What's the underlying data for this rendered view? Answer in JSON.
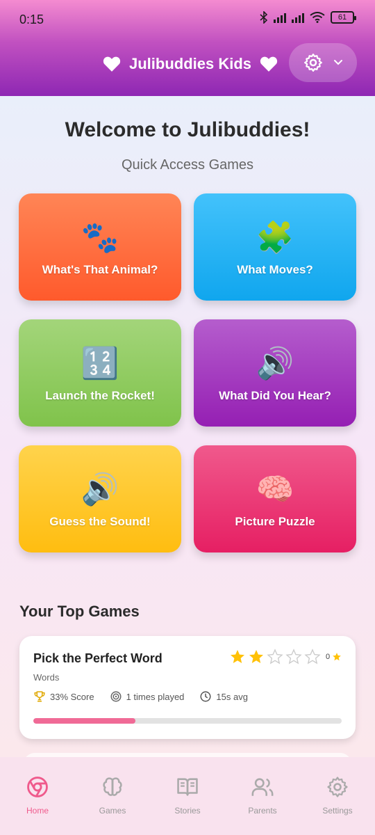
{
  "status_bar": {
    "time": "0:15",
    "battery": "61"
  },
  "header": {
    "title": "Julibuddies Kids"
  },
  "main": {
    "welcome": "Welcome to Julibuddies!",
    "subtitle": "Quick Access Games",
    "tiles": [
      {
        "label": "What's That Animal?",
        "emoji": "🐾"
      },
      {
        "label": "What Moves?",
        "emoji": "🧩"
      },
      {
        "label": "Launch the Rocket!",
        "emoji": "🔢"
      },
      {
        "label": "What Did You Hear?",
        "emoji": "🔊"
      },
      {
        "label": "Guess the Sound!",
        "emoji": "🔊"
      },
      {
        "label": "Picture Puzzle",
        "emoji": "🧠"
      }
    ],
    "top_games_title": "Your Top Games",
    "top_games": [
      {
        "name": "Pick the Perfect Word",
        "category": "Words",
        "stars_filled": 2,
        "stars_total": 5,
        "star_count": "0",
        "score": "33% Score",
        "played": "1 times played",
        "avg": "15s avg",
        "progress": 0.33
      }
    ]
  },
  "nav": [
    {
      "label": "Home",
      "icon": "home-icon",
      "active": true
    },
    {
      "label": "Games",
      "icon": "brain-icon"
    },
    {
      "label": "Stories",
      "icon": "book-icon"
    },
    {
      "label": "Parents",
      "icon": "users-icon"
    },
    {
      "label": "Settings",
      "icon": "gear-icon"
    }
  ],
  "colors": {
    "accent": "#ef5a8c",
    "header_start": "#f48bd0",
    "header_end": "#8e27b3",
    "star": "#ffc107"
  }
}
